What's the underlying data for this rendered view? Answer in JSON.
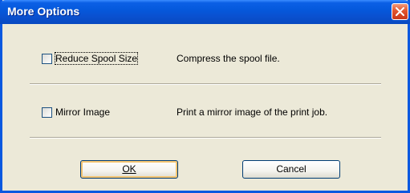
{
  "window": {
    "title": "More Options"
  },
  "options": [
    {
      "label": "Reduce Spool Size",
      "checked": false,
      "description": "Compress the spool file."
    },
    {
      "label": "Mirror Image",
      "checked": false,
      "description": "Print a mirror image of the print job."
    }
  ],
  "buttons": {
    "ok_label": "OK",
    "cancel_label": "Cancel"
  },
  "colors": {
    "titlebar": "#0559dc",
    "close": "#e0542d",
    "dialog_bg": "#ece9d8"
  }
}
